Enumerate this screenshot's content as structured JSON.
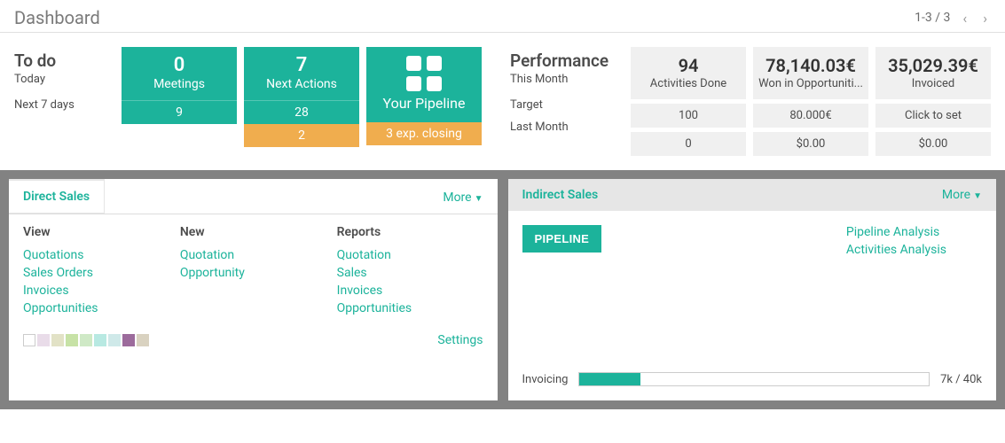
{
  "header": {
    "title": "Dashboard",
    "pager": "1-3 / 3"
  },
  "todo": {
    "heading": "To do",
    "today": "Today",
    "next7": "Next 7 days"
  },
  "tiles": {
    "meetings": {
      "today": "0",
      "label": "Meetings",
      "next7": "9"
    },
    "nextActions": {
      "today": "7",
      "label": "Next Actions",
      "next7": "28",
      "exp": "2"
    },
    "pipeline": {
      "label": "Your Pipeline",
      "closing": "3 exp. closing"
    }
  },
  "performance": {
    "heading": "Performance",
    "thisMonth": "This Month",
    "target": "Target",
    "lastMonth": "Last Month",
    "activities": {
      "value": "94",
      "label": "Activities Done",
      "target": "100",
      "last": "0"
    },
    "won": {
      "value": "78,140.03€",
      "label": "Won in Opportuniti...",
      "target": "80.000€",
      "last": "$0.00"
    },
    "invoiced": {
      "value": "35,029.39€",
      "label": "Invoiced",
      "target": "Click to set",
      "last": "$0.00"
    }
  },
  "panel1": {
    "title": "Direct Sales",
    "more": "More",
    "cols": {
      "view": {
        "heading": "View",
        "items": [
          "Quotations",
          "Sales Orders",
          "Invoices",
          "Opportunities"
        ]
      },
      "new": {
        "heading": "New",
        "items": [
          "Quotation",
          "Opportunity"
        ]
      },
      "reports": {
        "heading": "Reports",
        "items": [
          "Quotation",
          "Sales",
          "Invoices",
          "Opportunities"
        ]
      }
    },
    "settings": "Settings",
    "swatches": [
      "#ffffff",
      "#e9dce9",
      "#e2e2c6",
      "#c7e2a6",
      "#cfe9c6",
      "#b8e9e2",
      "#cfe9e9",
      "#9c6b9c",
      "#d9d2c0"
    ]
  },
  "panel2": {
    "title": "Indirect Sales",
    "more": "More",
    "pipelineBtn": "PIPELINE",
    "links": [
      "Pipeline Analysis",
      "Activities Analysis"
    ],
    "invoicing": {
      "label": "Invoicing",
      "ratio": "7k / 40k"
    }
  }
}
